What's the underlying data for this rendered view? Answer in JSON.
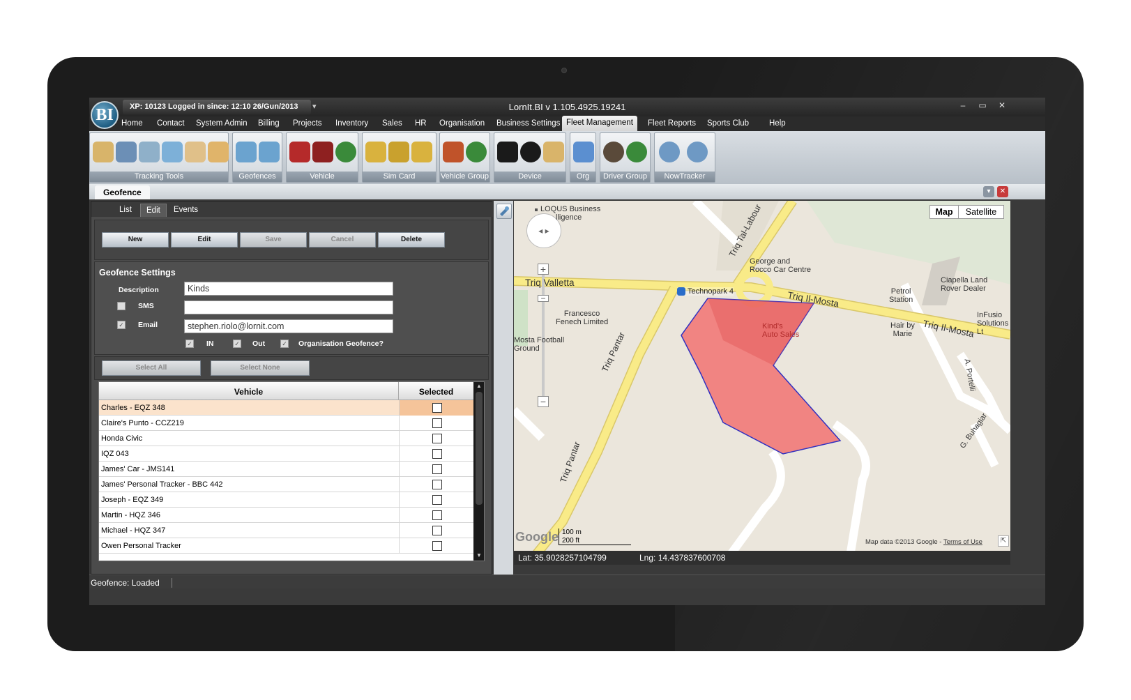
{
  "window": {
    "xp_info": "XP: 10123  Logged in since: 12:10 26/Gun/2013",
    "title": "LornIt.BI v 1.105.4925.19241",
    "logo": "BI",
    "minimize": "‒",
    "maximize": "▭",
    "close": "✕"
  },
  "menu": [
    "Home",
    "Contact",
    "System Admin",
    "Billing",
    "Projects",
    "Inventory",
    "Sales",
    "HR",
    "Organisation",
    "Business Settings",
    "Fleet Management",
    "Fleet Reports",
    "Sports Club",
    "Help"
  ],
  "menu_active": "Fleet Management",
  "ribbon": {
    "groups": [
      "Tracking Tools",
      "Geofences",
      "Vehicle",
      "Sim Card",
      "Vehicle Group",
      "Device",
      "Org",
      "Driver Group",
      "NowTracker"
    ]
  },
  "document_tab": "Geofence",
  "subtabs": [
    "List",
    "Edit",
    "Events"
  ],
  "actions": {
    "new": "New",
    "edit": "Edit",
    "save": "Save",
    "cancel": "Cancel",
    "delete": "Delete"
  },
  "settings": {
    "heading": "Geofence Settings",
    "description_label": "Description",
    "description_value": "Kinds",
    "sms_label": "SMS",
    "sms_value": "",
    "email_label": "Email",
    "email_value": "stephen.riolo@lornit.com",
    "in_label": "IN",
    "out_label": "Out",
    "org_label": "Organisation Geofence?"
  },
  "selection": {
    "select_all": "Select All",
    "select_none": "Select None"
  },
  "grid": {
    "columns": [
      "Vehicle",
      "Selected"
    ],
    "rows": [
      "Charles - EQZ 348",
      "Claire's Punto - CCZ219",
      "Honda Civic",
      "IQZ 043",
      "James' Car - JMS141",
      "James' Personal Tracker - BBC 442",
      "Joseph - EQZ 349",
      "Martin - HQZ 346",
      "Michael - HQZ 347",
      "Owen Personal Tracker"
    ]
  },
  "map": {
    "type_map": "Map",
    "type_satellite": "Satellite",
    "labels": {
      "loqus": "LOQUS Business",
      "loqus2": "lligence",
      "george": "George and",
      "george2": "Rocco Car Centre",
      "ciapella": "Ciapella Land",
      "ciapella2": "Rover Dealer",
      "petrol": "Petrol",
      "petrol2": "Station",
      "infusion": "InFusio",
      "infusion2": "Solutions Lt",
      "hair": "Hair by",
      "hair2": "Marie",
      "technopark": "Technopark 4",
      "francesco": "Francesco",
      "francesco2": "Fenech Limited",
      "mosta": "Mosta Football",
      "mosta2": "Ground",
      "kinds": "Kind's",
      "kinds2": "Auto Sales",
      "triq_valletta": "Triq Valletta",
      "triq_mosta1": "Triq Il-Mosta",
      "triq_mosta2": "Triq Il-Mosta",
      "triq_tal_labour": "Triq Tal-Labour",
      "triq_pantar1": "Triq Pantar",
      "triq_pantar2": "Triq Pantar",
      "a_portelli": "A. Portelli",
      "g_buhagiar": "G. Buhagiar"
    },
    "scale_m": "100 m",
    "scale_ft": "200 ft",
    "google": "Google",
    "attribution": "Map data ©2013 Google - ",
    "terms": "Terms of Use"
  },
  "coords": {
    "lat": "Lat: 35.9028257104799",
    "lng": "Lng: 14.437837600708"
  },
  "status": "Geofence: Loaded"
}
